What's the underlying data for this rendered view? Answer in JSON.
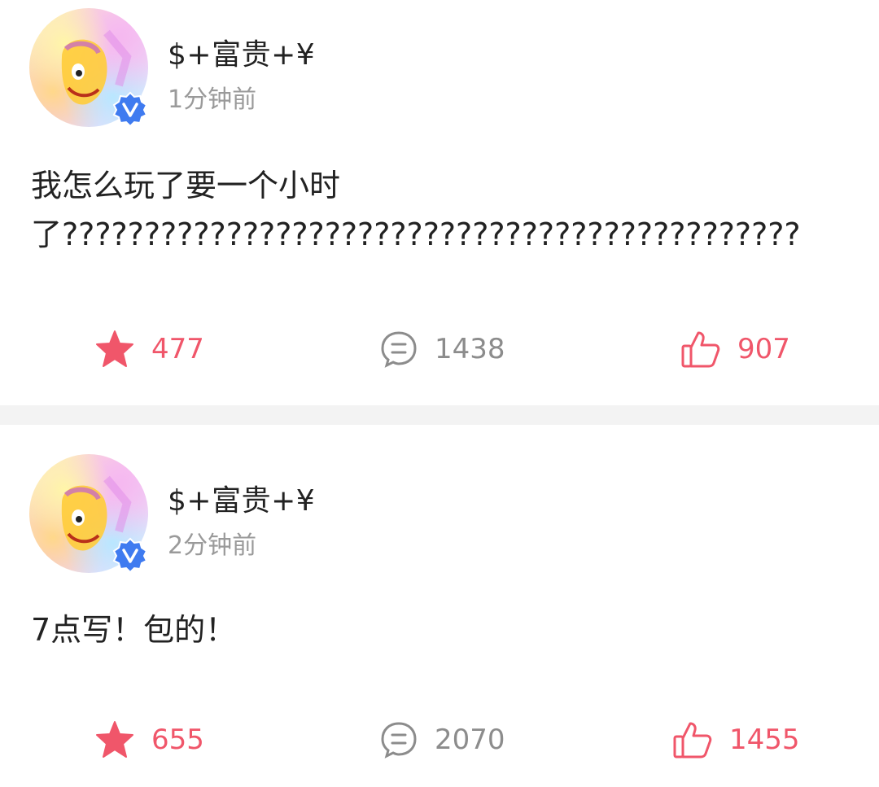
{
  "posts": [
    {
      "username": "$+富贵+¥",
      "time": "1分钟前",
      "verified": true,
      "content": "我怎么玩了要一个小时了?????????????????????????????????????????????",
      "actions": {
        "favorite": "477",
        "comment": "1438",
        "like": "907"
      }
    },
    {
      "username": "$+富贵+¥",
      "time": "2分钟前",
      "verified": true,
      "content": "7点写！包的！",
      "actions": {
        "favorite": "655",
        "comment": "2070",
        "like": "1455"
      }
    }
  ],
  "colors": {
    "accent_red": "#f0566a",
    "muted_gray": "#8c8c8c",
    "badge_blue": "#3f7bf0",
    "divider": "#f3f3f3"
  },
  "icons": {
    "favorite": "star-icon",
    "comment": "comment-bubble-icon",
    "like": "thumbs-up-icon",
    "verified": "verified-badge-icon"
  }
}
